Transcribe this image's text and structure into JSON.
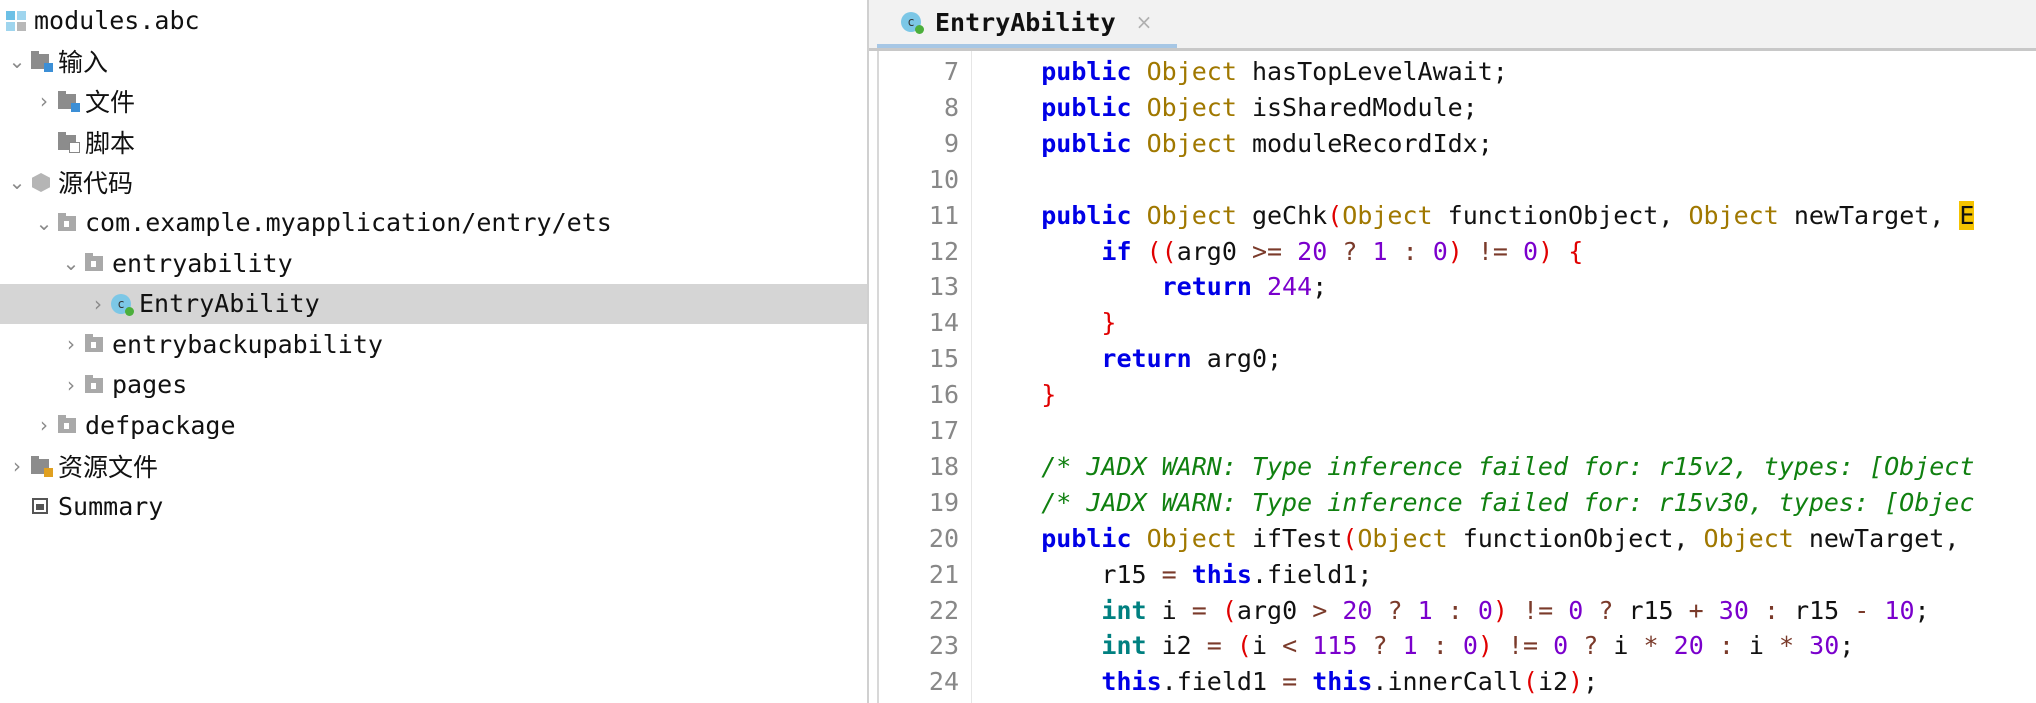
{
  "tree": [
    {
      "label": "modules.abc",
      "level": 0,
      "chevron": "",
      "icon": "module-icon"
    },
    {
      "label": "输入",
      "level": 0,
      "chevron": "down",
      "icon": "input-folder-icon"
    },
    {
      "label": "文件",
      "level": 1,
      "chevron": "right",
      "icon": "files-folder-icon"
    },
    {
      "label": "脚本",
      "level": 1,
      "chevron": "",
      "icon": "scripts-folder-icon"
    },
    {
      "label": "源代码",
      "level": 0,
      "chevron": "down",
      "icon": "source-package-icon"
    },
    {
      "label": "com.example.myapplication/entry/ets",
      "level": 1,
      "chevron": "down",
      "icon": "package-folder-icon"
    },
    {
      "label": "entryability",
      "level": 2,
      "chevron": "down",
      "icon": "package-folder-icon"
    },
    {
      "label": "EntryAbility",
      "level": 3,
      "chevron": "right",
      "icon": "class-icon",
      "selected": true
    },
    {
      "label": "entrybackupability",
      "level": 2,
      "chevron": "right",
      "icon": "package-folder-icon"
    },
    {
      "label": "pages",
      "level": 2,
      "chevron": "right",
      "icon": "package-folder-icon"
    },
    {
      "label": "defpackage",
      "level": 1,
      "chevron": "right",
      "icon": "package-folder-icon"
    },
    {
      "label": "资源文件",
      "level": 0,
      "chevron": "right",
      "icon": "resources-folder-icon"
    },
    {
      "label": "Summary",
      "level": 0,
      "chevron": "",
      "icon": "summary-icon"
    }
  ],
  "tab": {
    "label": "EntryAbility",
    "close": "×",
    "class_letter": "c"
  },
  "code": [
    {
      "n": "7",
      "t": [
        [
          "    ",
          ""
        ],
        [
          "public",
          "kw"
        ],
        [
          " ",
          ""
        ],
        [
          "Object",
          "ty"
        ],
        [
          " hasTopLevelAwait;",
          ""
        ]
      ]
    },
    {
      "n": "8",
      "t": [
        [
          "    ",
          ""
        ],
        [
          "public",
          "kw"
        ],
        [
          " ",
          ""
        ],
        [
          "Object",
          "ty"
        ],
        [
          " isSharedModule;",
          ""
        ]
      ]
    },
    {
      "n": "9",
      "t": [
        [
          "    ",
          ""
        ],
        [
          "public",
          "kw"
        ],
        [
          " ",
          ""
        ],
        [
          "Object",
          "ty"
        ],
        [
          " moduleRecordIdx;",
          ""
        ]
      ]
    },
    {
      "n": "10",
      "t": []
    },
    {
      "n": "11",
      "t": [
        [
          "    ",
          ""
        ],
        [
          "public",
          "kw"
        ],
        [
          " ",
          ""
        ],
        [
          "Object",
          "ty"
        ],
        [
          " geChk",
          ""
        ],
        [
          "(",
          "pa"
        ],
        [
          "Object",
          "ty"
        ],
        [
          " functionObject, ",
          ""
        ],
        [
          "Object",
          "ty"
        ],
        [
          " newTarget, ",
          ""
        ],
        [
          "E",
          "hl"
        ]
      ]
    },
    {
      "n": "12",
      "t": [
        [
          "        ",
          ""
        ],
        [
          "if",
          "kw"
        ],
        [
          " ",
          ""
        ],
        [
          "((",
          "pa"
        ],
        [
          "arg0 ",
          ""
        ],
        [
          ">=",
          "op"
        ],
        [
          " ",
          ""
        ],
        [
          "20",
          "nm"
        ],
        [
          " ",
          ""
        ],
        [
          "?",
          "op"
        ],
        [
          " ",
          ""
        ],
        [
          "1",
          "nm"
        ],
        [
          " ",
          ""
        ],
        [
          ":",
          "op"
        ],
        [
          " ",
          ""
        ],
        [
          "0",
          "nm"
        ],
        [
          ")",
          "pa"
        ],
        [
          " ",
          ""
        ],
        [
          "!=",
          "op"
        ],
        [
          " ",
          ""
        ],
        [
          "0",
          "nm"
        ],
        [
          ")",
          "pa"
        ],
        [
          " ",
          ""
        ],
        [
          "{",
          "pa"
        ]
      ]
    },
    {
      "n": "13",
      "t": [
        [
          "            ",
          ""
        ],
        [
          "return",
          "kw"
        ],
        [
          " ",
          ""
        ],
        [
          "244",
          "nm"
        ],
        [
          ";",
          ""
        ]
      ]
    },
    {
      "n": "14",
      "t": [
        [
          "        ",
          ""
        ],
        [
          "}",
          "pa"
        ]
      ]
    },
    {
      "n": "15",
      "t": [
        [
          "        ",
          ""
        ],
        [
          "return",
          "kw"
        ],
        [
          " arg0;",
          ""
        ]
      ]
    },
    {
      "n": "16",
      "t": [
        [
          "    ",
          ""
        ],
        [
          "}",
          "pa"
        ]
      ]
    },
    {
      "n": "17",
      "t": []
    },
    {
      "n": "18",
      "t": [
        [
          "    ",
          ""
        ],
        [
          "/* JADX WARN: Type inference failed for: r15v2, types: [Object",
          "cm"
        ]
      ]
    },
    {
      "n": "19",
      "t": [
        [
          "    ",
          ""
        ],
        [
          "/* JADX WARN: Type inference failed for: r15v30, types: [Objec",
          "cm"
        ]
      ]
    },
    {
      "n": "20",
      "t": [
        [
          "    ",
          ""
        ],
        [
          "public",
          "kw"
        ],
        [
          " ",
          ""
        ],
        [
          "Object",
          "ty"
        ],
        [
          " ifTest",
          ""
        ],
        [
          "(",
          "pa"
        ],
        [
          "Object",
          "ty"
        ],
        [
          " functionObject, ",
          ""
        ],
        [
          "Object",
          "ty"
        ],
        [
          " newTarget,",
          ""
        ]
      ]
    },
    {
      "n": "21",
      "t": [
        [
          "        r15 ",
          ""
        ],
        [
          "=",
          "op"
        ],
        [
          " ",
          ""
        ],
        [
          "this",
          "kw"
        ],
        [
          ".field1;",
          ""
        ]
      ]
    },
    {
      "n": "22",
      "t": [
        [
          "        ",
          ""
        ],
        [
          "int",
          "it"
        ],
        [
          " i ",
          ""
        ],
        [
          "=",
          "op"
        ],
        [
          " ",
          ""
        ],
        [
          "(",
          "pa"
        ],
        [
          "arg0 ",
          ""
        ],
        [
          ">",
          "op"
        ],
        [
          " ",
          ""
        ],
        [
          "20",
          "nm"
        ],
        [
          " ",
          ""
        ],
        [
          "?",
          "op"
        ],
        [
          " ",
          ""
        ],
        [
          "1",
          "nm"
        ],
        [
          " ",
          ""
        ],
        [
          ":",
          "op"
        ],
        [
          " ",
          ""
        ],
        [
          "0",
          "nm"
        ],
        [
          ")",
          "pa"
        ],
        [
          " ",
          ""
        ],
        [
          "!=",
          "op"
        ],
        [
          " ",
          ""
        ],
        [
          "0",
          "nm"
        ],
        [
          " ",
          ""
        ],
        [
          "?",
          "op"
        ],
        [
          " r15 ",
          ""
        ],
        [
          "+",
          "op"
        ],
        [
          " ",
          ""
        ],
        [
          "30",
          "nm"
        ],
        [
          " ",
          ""
        ],
        [
          ":",
          "op"
        ],
        [
          " r15 ",
          ""
        ],
        [
          "-",
          "op"
        ],
        [
          " ",
          ""
        ],
        [
          "10",
          "nm"
        ],
        [
          ";",
          ""
        ]
      ]
    },
    {
      "n": "23",
      "t": [
        [
          "        ",
          ""
        ],
        [
          "int",
          "it"
        ],
        [
          " i2 ",
          ""
        ],
        [
          "=",
          "op"
        ],
        [
          " ",
          ""
        ],
        [
          "(",
          "pa"
        ],
        [
          "i ",
          ""
        ],
        [
          "<",
          "op"
        ],
        [
          " ",
          ""
        ],
        [
          "115",
          "nm"
        ],
        [
          " ",
          ""
        ],
        [
          "?",
          "op"
        ],
        [
          " ",
          ""
        ],
        [
          "1",
          "nm"
        ],
        [
          " ",
          ""
        ],
        [
          ":",
          "op"
        ],
        [
          " ",
          ""
        ],
        [
          "0",
          "nm"
        ],
        [
          ")",
          "pa"
        ],
        [
          " ",
          ""
        ],
        [
          "!=",
          "op"
        ],
        [
          " ",
          ""
        ],
        [
          "0",
          "nm"
        ],
        [
          " ",
          ""
        ],
        [
          "?",
          "op"
        ],
        [
          " i ",
          ""
        ],
        [
          "*",
          "op"
        ],
        [
          " ",
          ""
        ],
        [
          "20",
          "nm"
        ],
        [
          " ",
          ""
        ],
        [
          ":",
          "op"
        ],
        [
          " i ",
          ""
        ],
        [
          "*",
          "op"
        ],
        [
          " ",
          ""
        ],
        [
          "30",
          "nm"
        ],
        [
          ";",
          ""
        ]
      ]
    },
    {
      "n": "24",
      "t": [
        [
          "        ",
          ""
        ],
        [
          "this",
          "kw"
        ],
        [
          ".field1 ",
          ""
        ],
        [
          "=",
          "op"
        ],
        [
          " ",
          ""
        ],
        [
          "this",
          "kw"
        ],
        [
          ".innerCall",
          ""
        ],
        [
          "(",
          "pa"
        ],
        [
          "i2",
          ""
        ],
        [
          ")",
          "pa"
        ],
        [
          ";",
          ""
        ]
      ]
    }
  ]
}
